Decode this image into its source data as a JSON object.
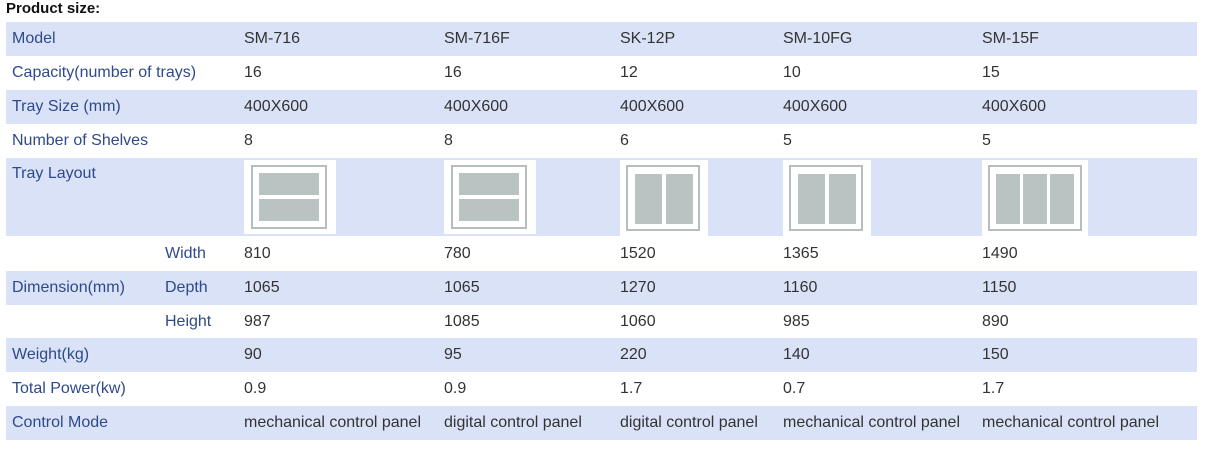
{
  "heading": "Product size:",
  "models": [
    "SM-716",
    "SM-716F",
    "SK-12P",
    "SM-10FG",
    "SM-15F"
  ],
  "rows": {
    "model": {
      "label": "Model",
      "values": [
        "SM-716",
        "SM-716F",
        "SK-12P",
        "SM-10FG",
        "SM-15F"
      ]
    },
    "capacity": {
      "label": "Capacity(number of trays)",
      "values": [
        "16",
        "16",
        "12",
        "10",
        "15"
      ]
    },
    "tray_size": {
      "label": "Tray Size (mm)",
      "values": [
        "400X600",
        "400X600",
        "400X600",
        "400X600",
        "400X600"
      ]
    },
    "shelves": {
      "label": "Number of Shelves",
      "values": [
        "8",
        "8",
        "6",
        "5",
        "5"
      ]
    },
    "tray_layout": {
      "label": "Tray Layout",
      "layouts": [
        "two-horizontal",
        "two-horizontal",
        "two-vertical",
        "two-vertical",
        "three-vertical"
      ]
    },
    "width": {
      "label": "Width",
      "values": [
        "810",
        "780",
        "1520",
        "1365",
        "1490"
      ]
    },
    "depth": {
      "label": "Depth",
      "group_label": "Dimension(mm)",
      "values": [
        "1065",
        "1065",
        "1270",
        "1160",
        "1150"
      ]
    },
    "height": {
      "label": "Height",
      "values": [
        "987",
        "1085",
        "1060",
        "985",
        "890"
      ]
    },
    "weight": {
      "label": "Weight(kg)",
      "values": [
        "90",
        "95",
        "220",
        "140",
        "150"
      ]
    },
    "power": {
      "label": "Total Power(kw)",
      "values": [
        "0.9",
        "0.9",
        "1.7",
        "0.7",
        "1.7"
      ]
    },
    "control": {
      "label": "Control Mode",
      "values": [
        "mechanical control panel",
        "digital control panel",
        "digital control panel",
        "mechanical control panel",
        "mechanical control panel"
      ]
    }
  },
  "colors": {
    "row_shade": "#d9e2f7",
    "label_text": "#2e4a8a",
    "tray_fill": "#b9c3c2"
  }
}
